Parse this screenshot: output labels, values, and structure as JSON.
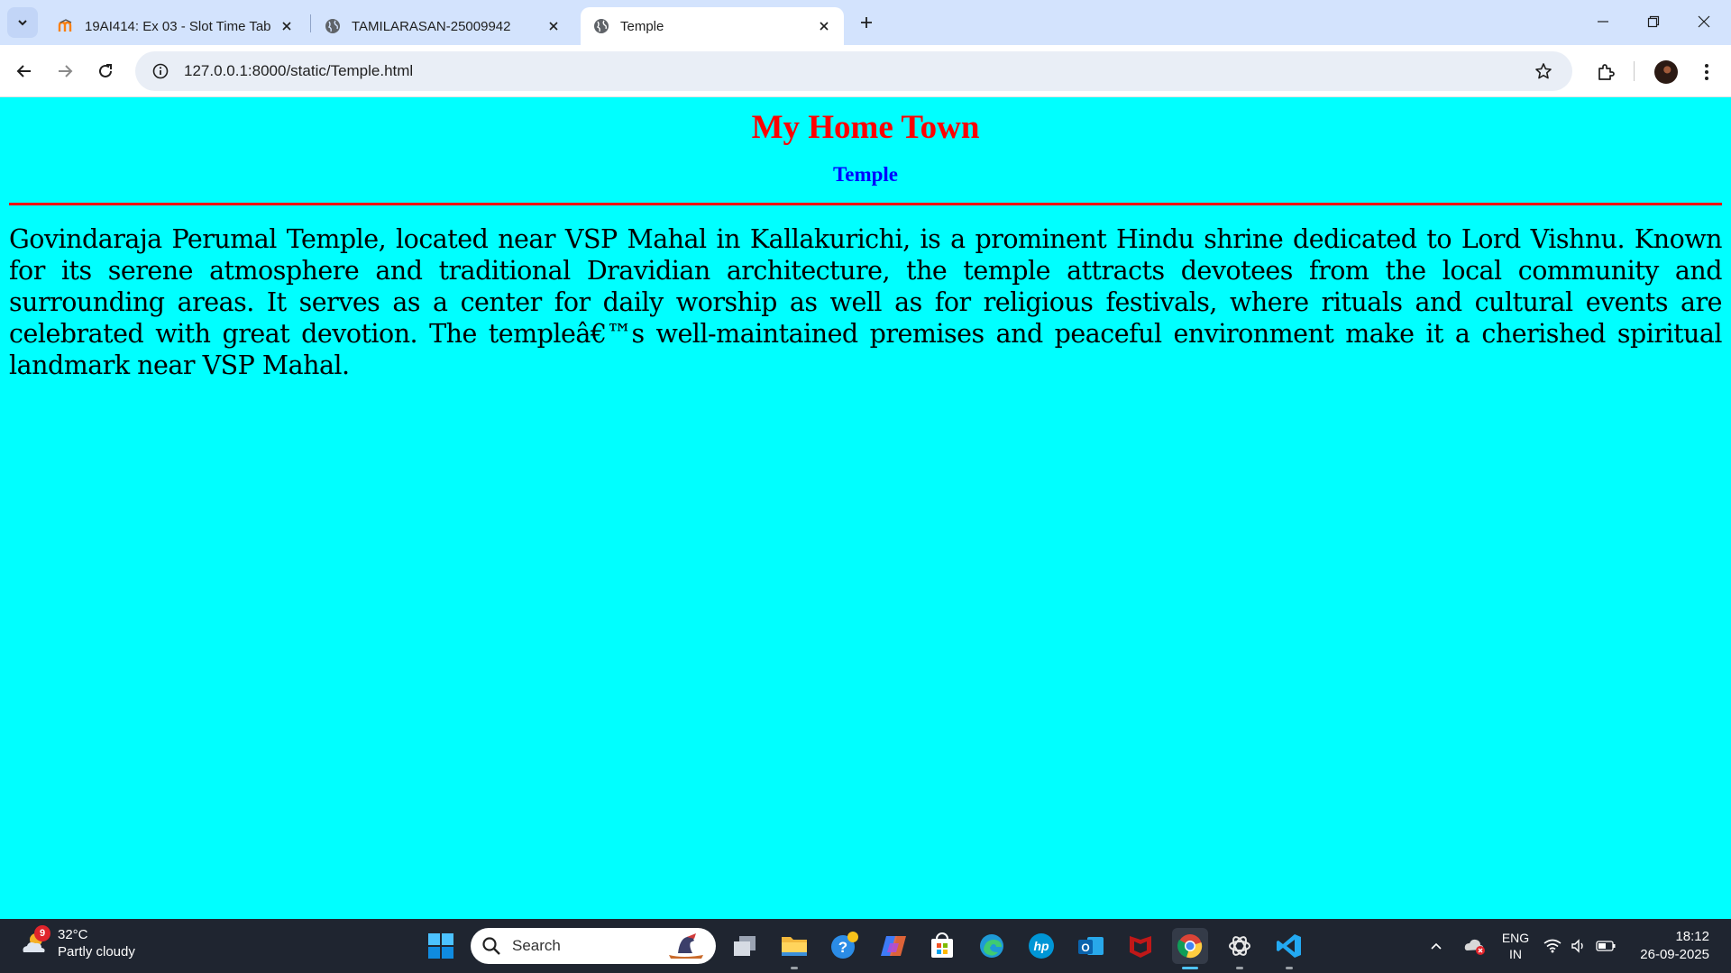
{
  "browser": {
    "tabs": [
      {
        "title": "19AI414: Ex 03 - Slot Time Table",
        "favicon": "moodle-icon",
        "active": false
      },
      {
        "title": "TAMILARASAN-25009942",
        "favicon": "globe-icon",
        "active": false
      },
      {
        "title": "Temple",
        "favicon": "globe-icon",
        "active": true
      }
    ],
    "url": "127.0.0.1:8000/static/Temple.html"
  },
  "page": {
    "heading": "My Home Town",
    "subheading": "Temple",
    "paragraph": "Govindaraja Perumal Temple, located near VSP Mahal in Kallakurichi, is a prominent Hindu shrine dedicated to Lord Vishnu. Known for its serene atmosphere and traditional Dravidian architecture, the temple attracts devotees from the local community and surrounding areas. It serves as a center for daily worship as well as for religious festivals, where rituals and cultural events are celebrated with great devotion. The templeâ€™s well-maintained premises and peaceful environment make it a cherished spiritual landmark near VSP Mahal.",
    "colors": {
      "background": "#00ffff",
      "heading": "#ff0000",
      "subheading": "#0000ff",
      "rule": "#ff0000"
    }
  },
  "taskbar": {
    "weather": {
      "temp": "32°C",
      "condition": "Partly cloudy",
      "badge": "9"
    },
    "search_placeholder": "Search",
    "pinned_apps": [
      "task-view-icon",
      "file-explorer-icon",
      "help-icon",
      "copilot-icon",
      "microsoft-store-icon",
      "edge-icon",
      "hp-icon",
      "outlook-icon",
      "mcafee-icon",
      "chrome-icon",
      "chatgpt-icon",
      "vscode-icon"
    ],
    "language": {
      "line1": "ENG",
      "line2": "IN"
    },
    "clock": {
      "time": "18:12",
      "date": "26-09-2025"
    }
  }
}
